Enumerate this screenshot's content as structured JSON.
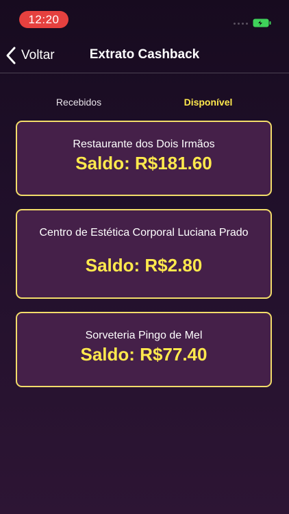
{
  "status_bar": {
    "time": "12:20",
    "colors": {
      "time_pill": "#e5413f",
      "battery": "#3fd25a"
    }
  },
  "nav": {
    "back_label": "Voltar",
    "title": "Extrato Cashback"
  },
  "tabs": [
    {
      "label": "Recebidos",
      "active": false
    },
    {
      "label": "Disponível",
      "active": true
    }
  ],
  "cards": [
    {
      "name": "Restaurante dos Dois Irmãos",
      "balance": "Saldo: R$181.60"
    },
    {
      "name": "Centro de Estética Corporal Luciana Prado",
      "balance": "Saldo: R$2.80"
    },
    {
      "name": "Sorveteria Pingo de Mel",
      "balance": "Saldo: R$77.40"
    }
  ],
  "colors": {
    "accent": "#ffe94d",
    "card_border": "#f3dd6a",
    "card_background": "#452049",
    "background_top": "#170b1f",
    "background_bottom": "#2d1534"
  }
}
